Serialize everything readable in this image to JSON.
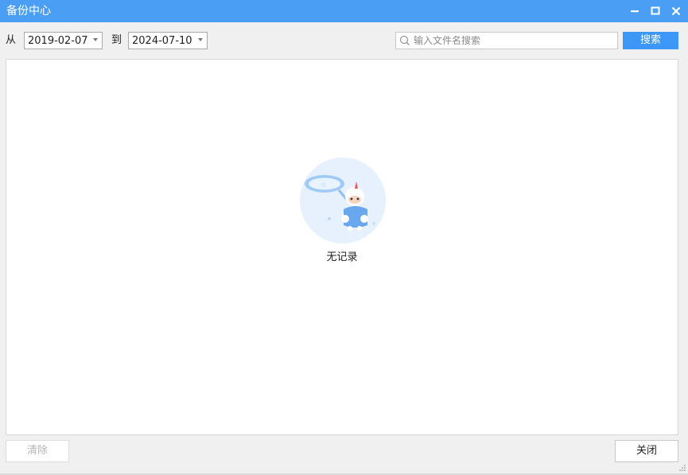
{
  "window": {
    "title": "备份中心",
    "controls": [
      "minimize-icon",
      "maximize-icon",
      "close-icon"
    ]
  },
  "filters": {
    "from_label": "从",
    "from_date": "2019-02-07",
    "to_label": "到",
    "to_date": "2024-07-10",
    "search_placeholder": "输入文件名搜索",
    "search_value": "",
    "search_button": "搜索"
  },
  "content": {
    "empty_text": "无记录"
  },
  "footer": {
    "clear_button": "清除",
    "close_button": "关闭"
  },
  "colors": {
    "titlebar": "#4a9ff5",
    "accent": "#3d97f6"
  }
}
